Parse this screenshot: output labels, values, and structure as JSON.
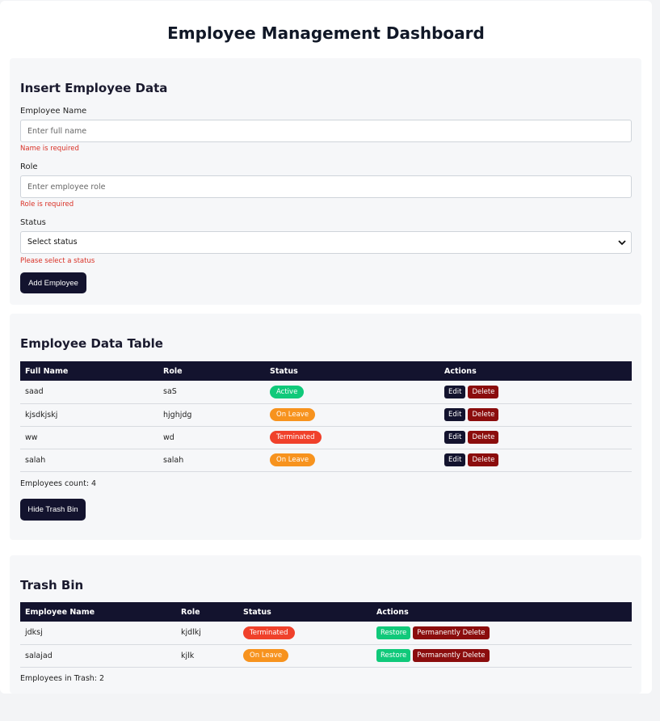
{
  "page": {
    "title": "Employee Management Dashboard"
  },
  "insert": {
    "title": "Insert Employee Data",
    "name_label": "Employee Name",
    "name_placeholder": "Enter full name",
    "name_error": "Name is required",
    "role_label": "Role",
    "role_placeholder": "Enter employee role",
    "role_error": "Role is required",
    "status_label": "Status",
    "status_value": "Select status",
    "status_error": "Please select a status",
    "submit_label": "Add Employee"
  },
  "table": {
    "title": "Employee Data Table",
    "headers": [
      "Full Name",
      "Role",
      "Status",
      "Actions"
    ],
    "rows": [
      {
        "name": "saad",
        "role": "saS",
        "status": "Active"
      },
      {
        "name": "kjsdkjskj",
        "role": "hjghjdg",
        "status": "On Leave"
      },
      {
        "name": "ww",
        "role": "wd",
        "status": "Terminated"
      },
      {
        "name": "salah",
        "role": "salah",
        "status": "On Leave"
      }
    ],
    "edit_label": "Edit",
    "delete_label": "Delete",
    "count_text": "Employees count: 4",
    "toggle_trash_label": "Hide Trash Bin"
  },
  "trash": {
    "title": "Trash Bin",
    "headers": [
      "Employee Name",
      "Role",
      "Status",
      "Actions"
    ],
    "rows": [
      {
        "name": "jdksj",
        "role": "kjdlkj",
        "status": "Terminated"
      },
      {
        "name": "salajad",
        "role": "kjlk",
        "status": "On Leave"
      }
    ],
    "restore_label": "Restore",
    "perm_delete_label": "Permanently Delete",
    "count_text": "Employees in Trash: 2"
  },
  "colors": {
    "navy": "#13132e",
    "active": "#10c97a",
    "on_leave": "#f7931e",
    "terminated": "#f0412b",
    "danger": "#8b0d0d",
    "restore": "#10c97a",
    "error_text": "#d93025"
  },
  "icons": {
    "select_chevron": "chevron-down-icon"
  }
}
